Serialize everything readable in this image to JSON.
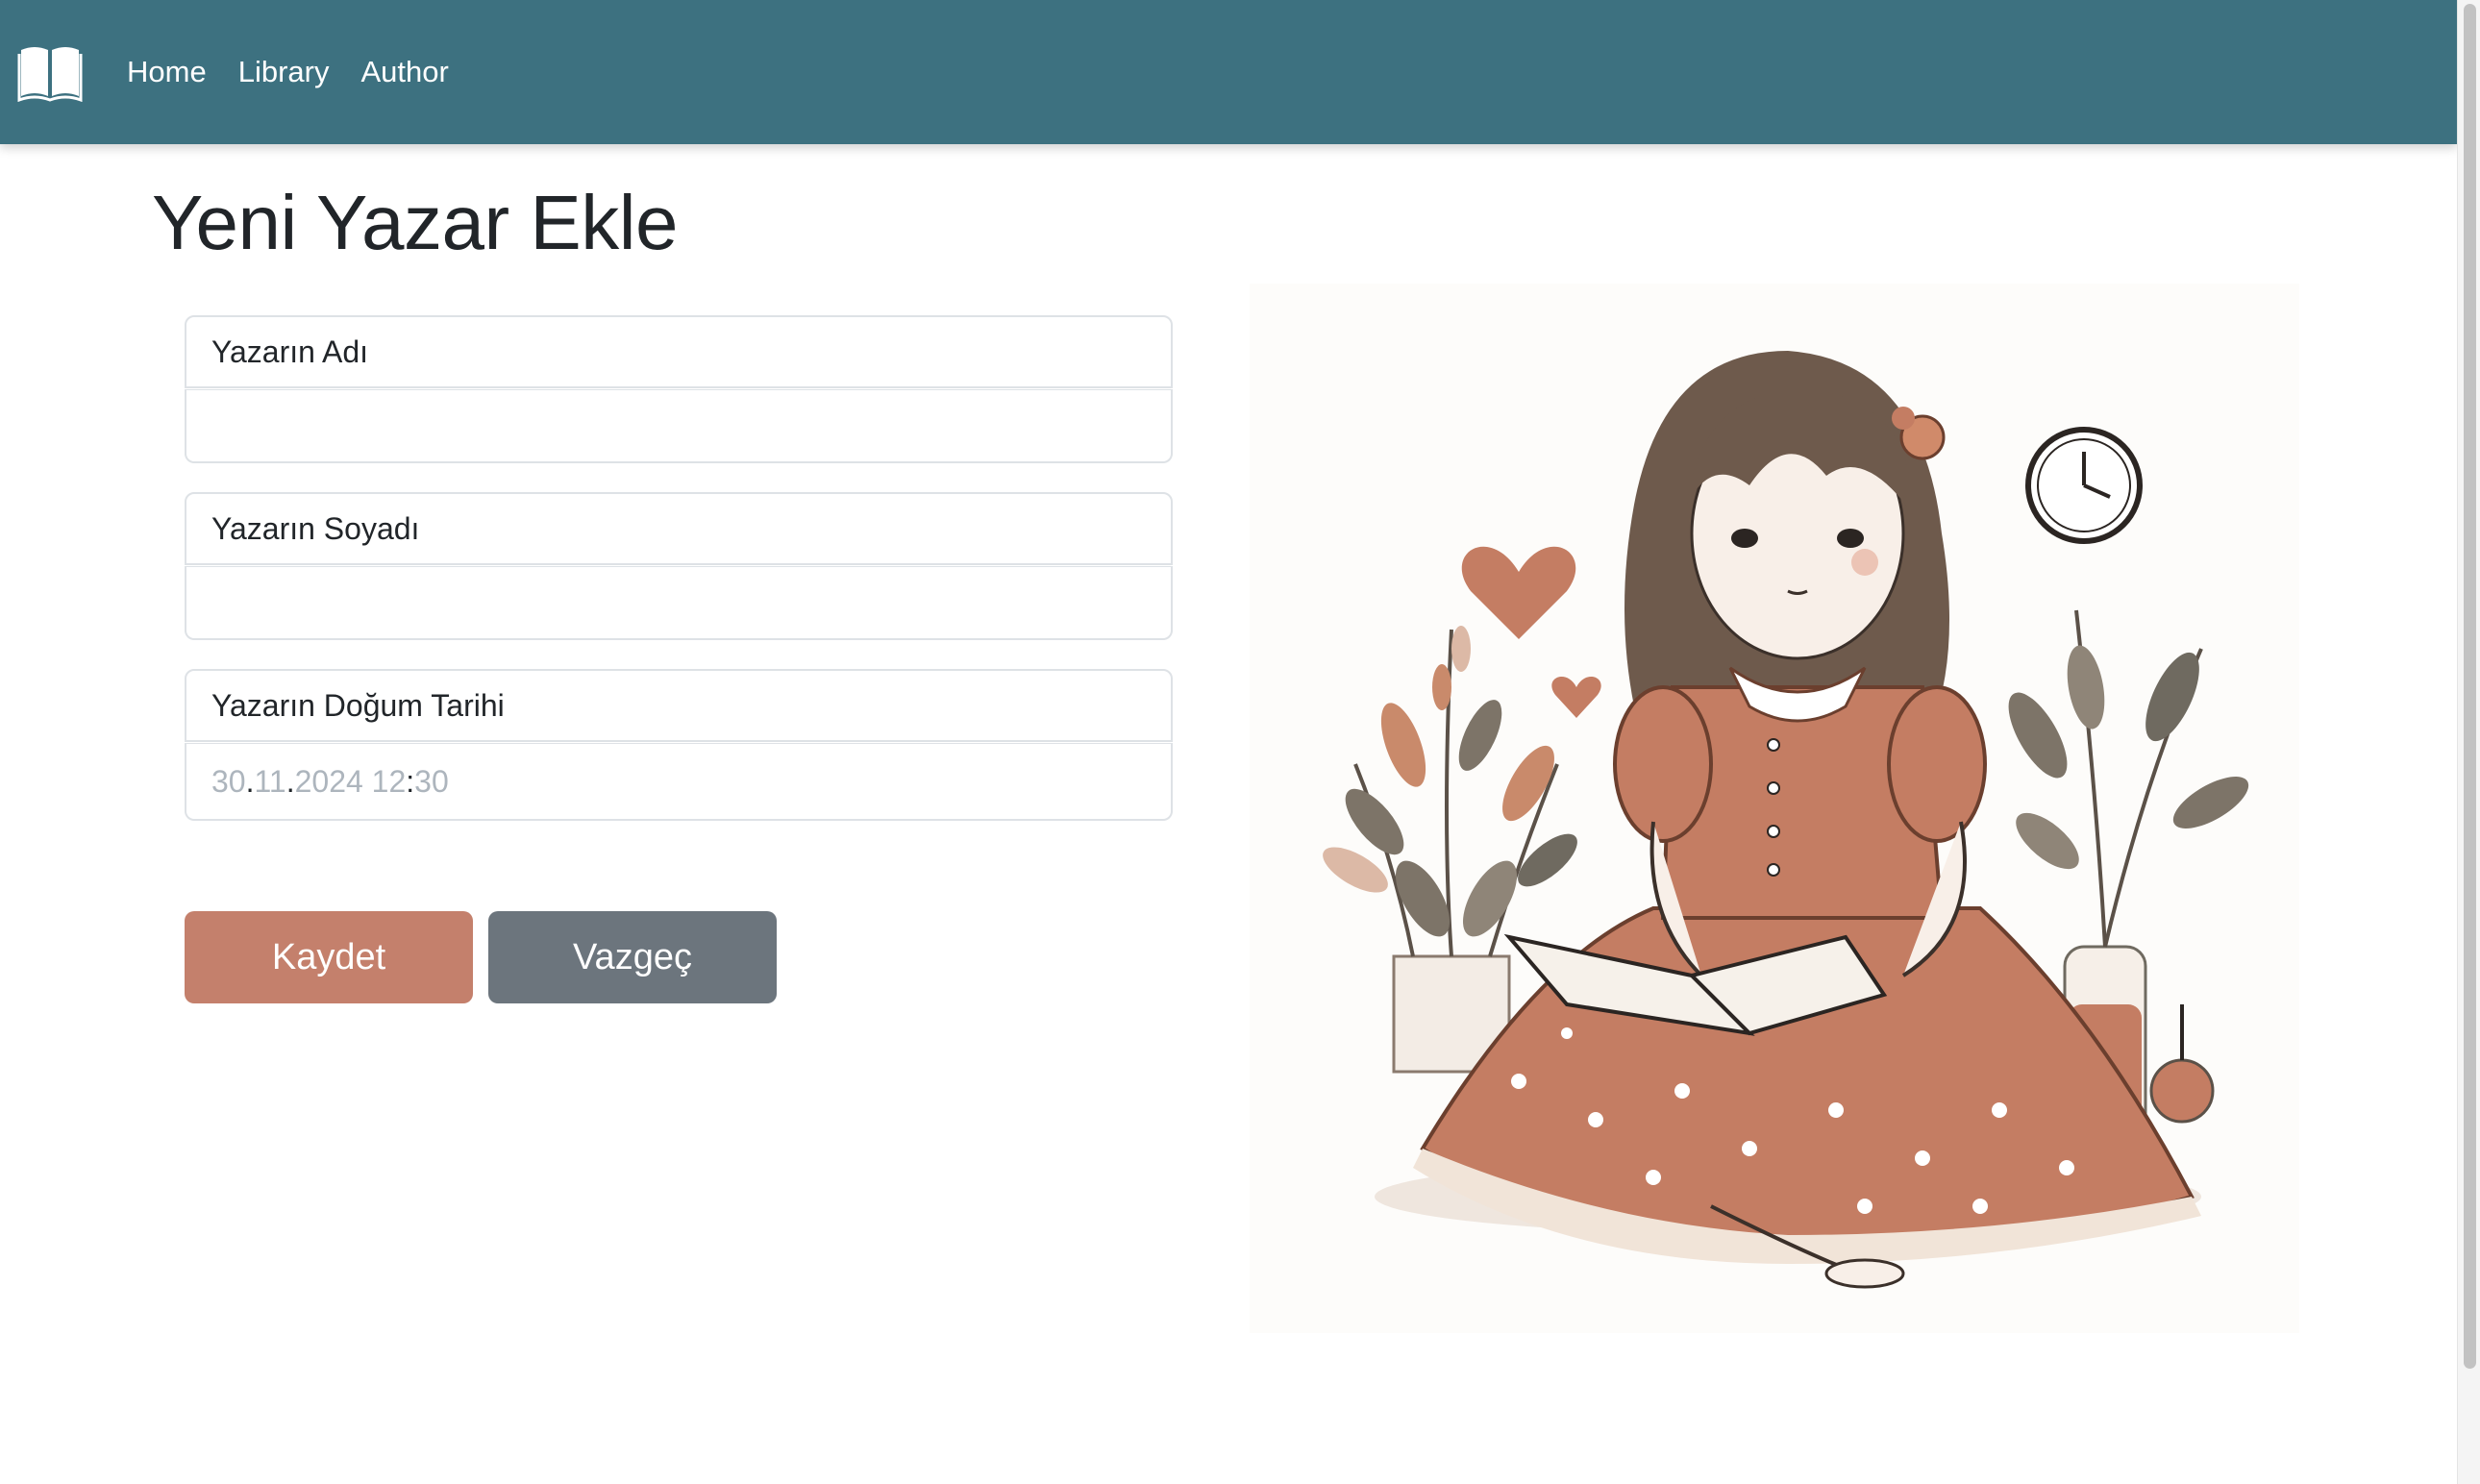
{
  "nav": {
    "brand_icon": "open-book-icon",
    "links": [
      "Home",
      "Library",
      "Author"
    ]
  },
  "page": {
    "title": "Yeni Yazar Ekle"
  },
  "form": {
    "first_name_label": "Yazarın Adı",
    "first_name_value": "",
    "last_name_label": "Yazarın Soyadı",
    "last_name_value": "",
    "birth_date_label": "Yazarın Doğum Tarihi",
    "birth_date": {
      "day": "30",
      "month": "11",
      "year": "2024",
      "hour": "12",
      "minute": "30"
    }
  },
  "buttons": {
    "save": "Kaydet",
    "cancel": "Vazgeç"
  },
  "colors": {
    "navbar": "#3d7180",
    "save_button": "#c4806c",
    "cancel_button": "#6c757d"
  },
  "illustration": {
    "description_icon": "girl-reading-book-illustration"
  }
}
